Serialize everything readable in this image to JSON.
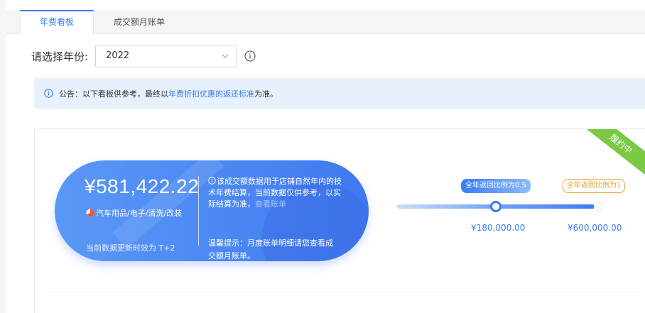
{
  "tabs": [
    {
      "label": "年费看板",
      "active": true
    },
    {
      "label": "成交额月账单",
      "active": false
    }
  ],
  "year_filter": {
    "label": "请选择年份:",
    "value": "2022"
  },
  "notice": {
    "prefix": "公告：以下看板供参考，最终以",
    "link": "年费折扣优惠的返还标准",
    "suffix": "为准。"
  },
  "card": {
    "ribbon": "履约中",
    "amount": "¥581,422.22",
    "category": "汽车用品/电子/清洗/改装",
    "update_note": "当前数据更新时效为 T+2",
    "description": "该成交额数据用于店铺自然年内的技术年费结算，当前数据仅供参考，以实际结算为准，",
    "description_link": "查看账单",
    "tip": "温馨提示：月度账单明细请您查看成交额月账单。"
  },
  "progress": {
    "current_fraction": 0.5,
    "marker_a_label": "全年返回比例为0.5",
    "marker_b_label": "全年返回比例为1",
    "price_a": "¥180,000.00",
    "price_b": "¥600,000.00"
  },
  "icons": [
    "info-icon",
    "chevron-down-icon",
    "pie-icon"
  ],
  "colors": {
    "accent": "#3a7bf5",
    "ribbon": "#7ac943",
    "warning": "#e0a23a",
    "notice_bg": "#e7f1fd"
  }
}
